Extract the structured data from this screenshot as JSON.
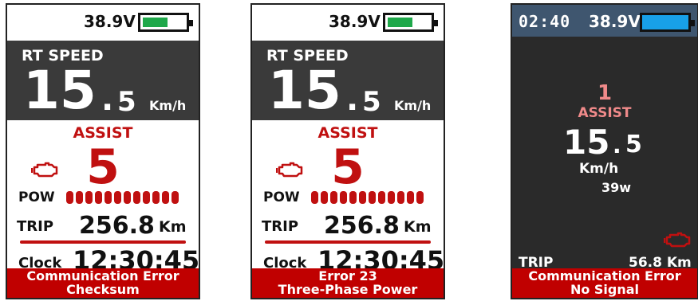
{
  "colors": {
    "assist_red": "#c01010",
    "error_bg": "#c00000",
    "battery_green": "#1fa84a",
    "battery_blue": "#18a0e8",
    "dark_header": "#3f566f"
  },
  "screens": [
    {
      "voltage": "38.9V",
      "battery_level": 0.55,
      "speed_label": "RT SPEED",
      "speed_int": "15",
      "speed_dot": ".",
      "speed_dec": "5",
      "speed_unit": "Km/h",
      "assist_label": "ASSIST",
      "assist_level": "5",
      "engine_icon": "engine-warning-icon",
      "power_label": "POW",
      "power_segments": 12,
      "trip_label": "TRIP",
      "trip_value": "256.8",
      "trip_unit": "Km",
      "clock_label": "Clock",
      "clock_value": "12:30:45",
      "error_line1": "Communication Error",
      "error_line2": "Checksum"
    },
    {
      "voltage": "38.9V",
      "battery_level": 0.55,
      "speed_label": "RT SPEED",
      "speed_int": "15",
      "speed_dot": ".",
      "speed_dec": "5",
      "speed_unit": "Km/h",
      "assist_label": "ASSIST",
      "assist_level": "5",
      "engine_icon": "engine-warning-icon",
      "power_label": "POW",
      "power_segments": 12,
      "trip_label": "TRIP",
      "trip_value": "256.8",
      "trip_unit": "Km",
      "clock_label": "Clock",
      "clock_value": "12:30:45",
      "error_line1": "Error 23",
      "error_line2": "Three-Phase Power"
    },
    {
      "time": "02:40",
      "voltage": "38.9V",
      "battery_level": 1.0,
      "assist_level": "1",
      "assist_label": "ASSIST",
      "speed_int": "15",
      "speed_dot": ".",
      "speed_dec": "5",
      "speed_unit": "Km/h",
      "power": "39w",
      "engine_icon": "engine-warning-icon",
      "trip_label": "TRIP",
      "trip_value": "56.8 Km",
      "error_line1": "Communication Error",
      "error_line2": "No Signal"
    }
  ]
}
